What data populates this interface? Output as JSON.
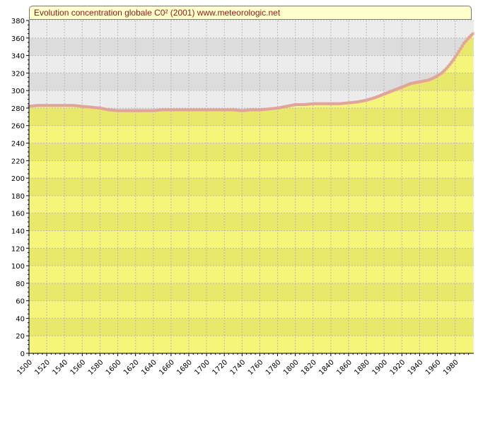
{
  "title": "Evolution concentration globale C0²  (2001) www.meteorologic.net",
  "colors": {
    "title_bg": "#ffffcc",
    "title_text": "#8b1a1a",
    "area_fill": "#f5f57a",
    "area_band": "#e8e86a",
    "line": "#e8c56a",
    "marker": "#e0a0a0",
    "bg_light": "#ececec",
    "bg_dark": "#dcdcdc"
  },
  "chart_data": {
    "type": "area",
    "title": "Evolution concentration globale C0²  (2001) www.meteorologic.net",
    "xlabel": "",
    "ylabel": "",
    "xlim": [
      1500,
      2001
    ],
    "ylim": [
      0,
      380
    ],
    "grid": true,
    "x_ticks": [
      1500,
      1520,
      1540,
      1560,
      1580,
      1600,
      1620,
      1640,
      1660,
      1680,
      1700,
      1720,
      1740,
      1760,
      1780,
      1800,
      1820,
      1840,
      1860,
      1880,
      1900,
      1920,
      1940,
      1960,
      1980
    ],
    "y_ticks": [
      0,
      20,
      40,
      60,
      80,
      100,
      120,
      140,
      160,
      180,
      200,
      220,
      240,
      260,
      280,
      300,
      320,
      340,
      360,
      380
    ],
    "x": [
      1500,
      1510,
      1520,
      1530,
      1540,
      1550,
      1560,
      1570,
      1580,
      1590,
      1600,
      1610,
      1620,
      1630,
      1640,
      1650,
      1660,
      1670,
      1680,
      1690,
      1700,
      1710,
      1720,
      1730,
      1740,
      1750,
      1760,
      1770,
      1780,
      1790,
      1800,
      1810,
      1820,
      1830,
      1840,
      1850,
      1860,
      1870,
      1880,
      1890,
      1900,
      1910,
      1920,
      1930,
      1940,
      1950,
      1955,
      1960,
      1965,
      1970,
      1975,
      1980,
      1985,
      1990,
      1995,
      2000
    ],
    "values": [
      282,
      283,
      283,
      283,
      283,
      283,
      282,
      281,
      280,
      278,
      277,
      277,
      277,
      277,
      277,
      278,
      278,
      278,
      278,
      278,
      278,
      278,
      278,
      278,
      277,
      278,
      278,
      279,
      280,
      282,
      284,
      284,
      285,
      285,
      285,
      285,
      286,
      287,
      289,
      292,
      296,
      300,
      304,
      308,
      310,
      312,
      314,
      317,
      320,
      325,
      331,
      338,
      346,
      354,
      360,
      365
    ]
  }
}
